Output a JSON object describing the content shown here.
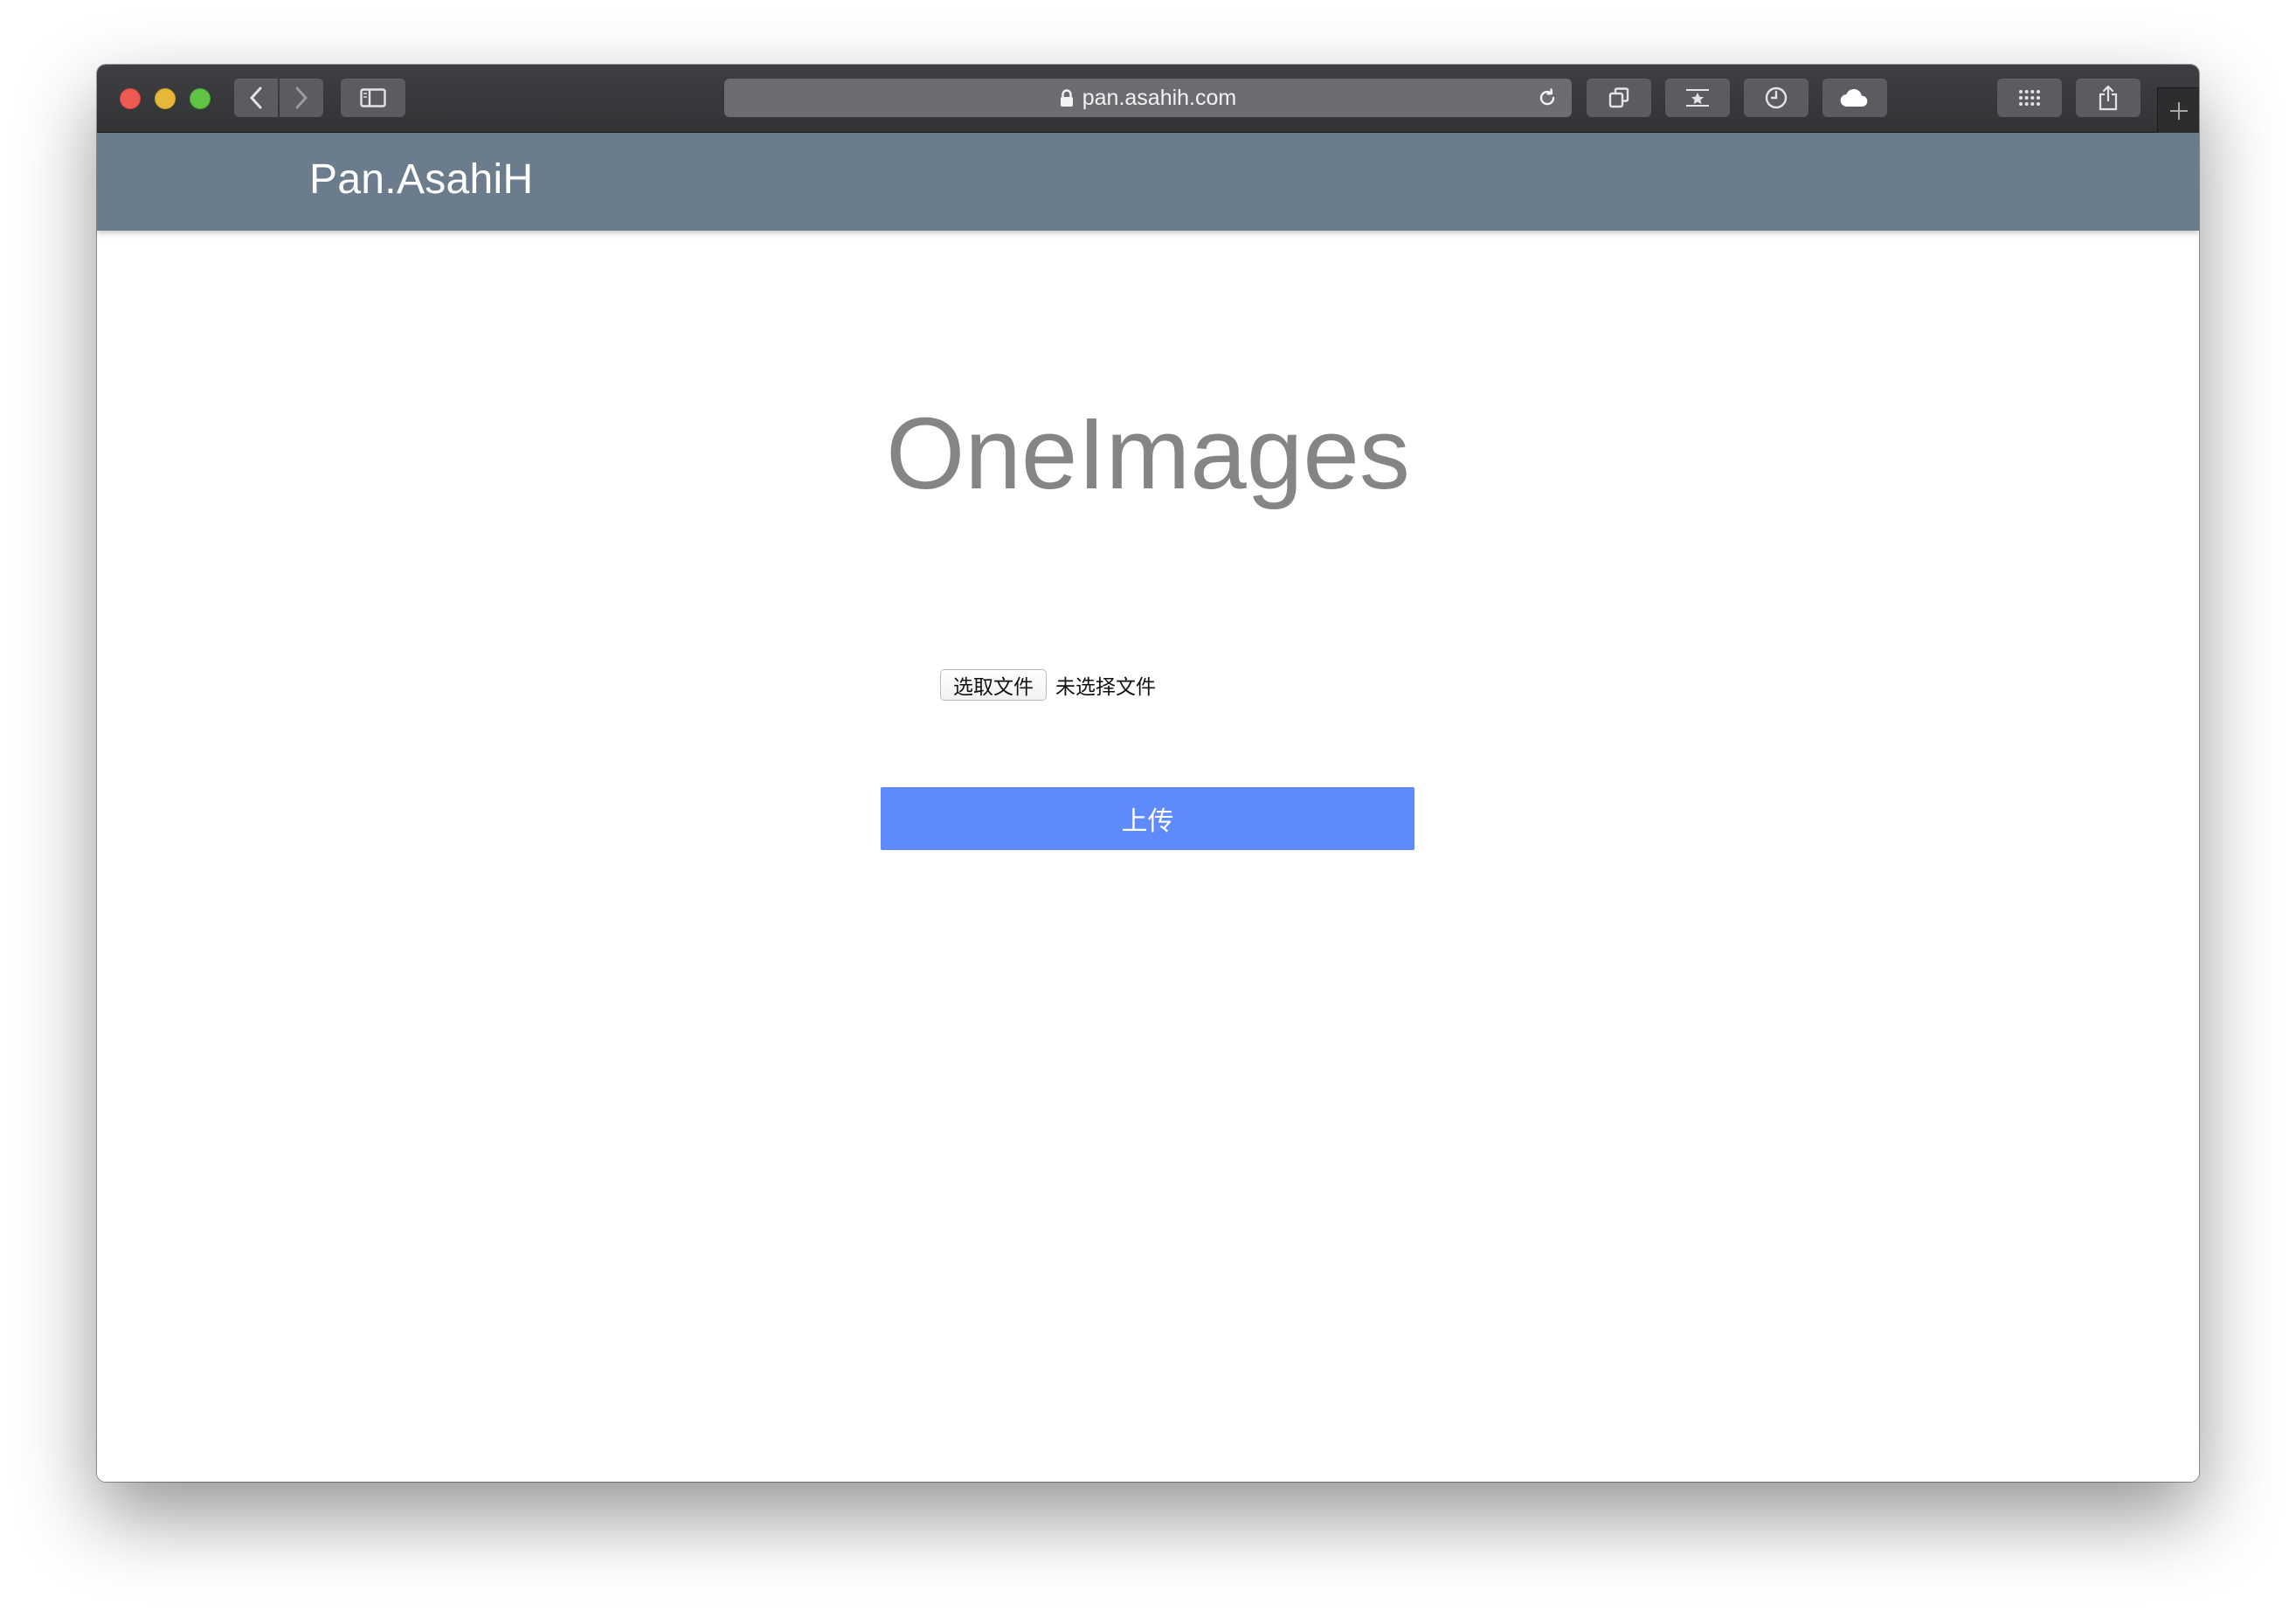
{
  "browser": {
    "url": "pan.asahih.com",
    "icons": [
      "close-icon",
      "minimize-icon",
      "maximize-icon",
      "back-icon",
      "forward-icon",
      "sidebar-icon",
      "lock-icon",
      "reload-icon",
      "tabs-icon",
      "reader-icon",
      "history-icon",
      "cloud-icon",
      "grid-icon",
      "share-icon",
      "plus-icon"
    ],
    "colors": {
      "close": "#ee5b53",
      "minimize": "#e6b83a",
      "maximize": "#5fc343"
    }
  },
  "site": {
    "brand": "Pan.AsahiH",
    "navbar_color": "#6b7d8c"
  },
  "main": {
    "title": "OneImages",
    "file_button_label": "选取文件",
    "file_status": "未选择文件",
    "upload_label": "上传",
    "upload_color": "#5f8bfa"
  }
}
